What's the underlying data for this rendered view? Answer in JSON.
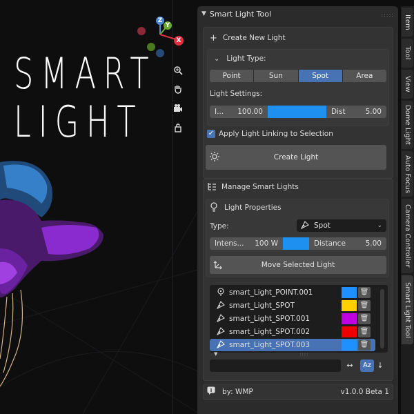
{
  "logo": {
    "line1": "SMART",
    "line2": "LIGHT"
  },
  "gizmo": {
    "z": "Z",
    "y": "Y",
    "x": "X"
  },
  "viewport_tools": [
    "zoom-icon",
    "hand-icon",
    "camera-icon",
    "lock-icon"
  ],
  "panel": {
    "title": "Smart Light Tool",
    "create_section": "Create New Light",
    "light_type_label": "Light Type:",
    "light_types": [
      "Point",
      "Sun",
      "Spot",
      "Area"
    ],
    "active_light_type": "Spot",
    "light_settings_label": "Light Settings:",
    "intensity_label": "I...",
    "intensity_value": "100.00",
    "dist_label": "Dist",
    "dist_value": "5.00",
    "apply_linking": "Apply Light Linking to Selection",
    "apply_linking_checked": true,
    "create_button": "Create Light",
    "manage_section": "Manage Smart Lights",
    "properties_label": "Light Properties",
    "type_label": "Type:",
    "type_value": "Spot",
    "prop_intensity_label": "Intens...",
    "prop_intensity_value": "100 W",
    "prop_distance_label": "Distance",
    "prop_distance_value": "5.00",
    "move_button": "Move Selected Light",
    "lights": [
      {
        "name": "smart_Light_POINT.001",
        "color": "#1e90ff",
        "icon": "point"
      },
      {
        "name": "smart_Light_SPOT",
        "color": "#ffd000",
        "icon": "spot"
      },
      {
        "name": "smart_Light_SPOT.001",
        "color": "#c000e0",
        "icon": "spot"
      },
      {
        "name": "smart_Light_SPOT.002",
        "color": "#ee0000",
        "icon": "spot"
      },
      {
        "name": "smart_Light_SPOT.003",
        "color": "#1e90ff",
        "icon": "spot",
        "selected": true
      }
    ],
    "footer_author": "by: WMP",
    "footer_version": "v1.0.0 Beta 1"
  },
  "tabs": [
    "Item",
    "Tool",
    "View",
    "Dome Light",
    "Auto Focus",
    "Camera Controller",
    "Smart Light Tool"
  ],
  "colors": {
    "accent": "#4772b3",
    "panel_bg": "#2b2b2b",
    "widget": "#545454",
    "light_blue": "#1e90f0"
  }
}
